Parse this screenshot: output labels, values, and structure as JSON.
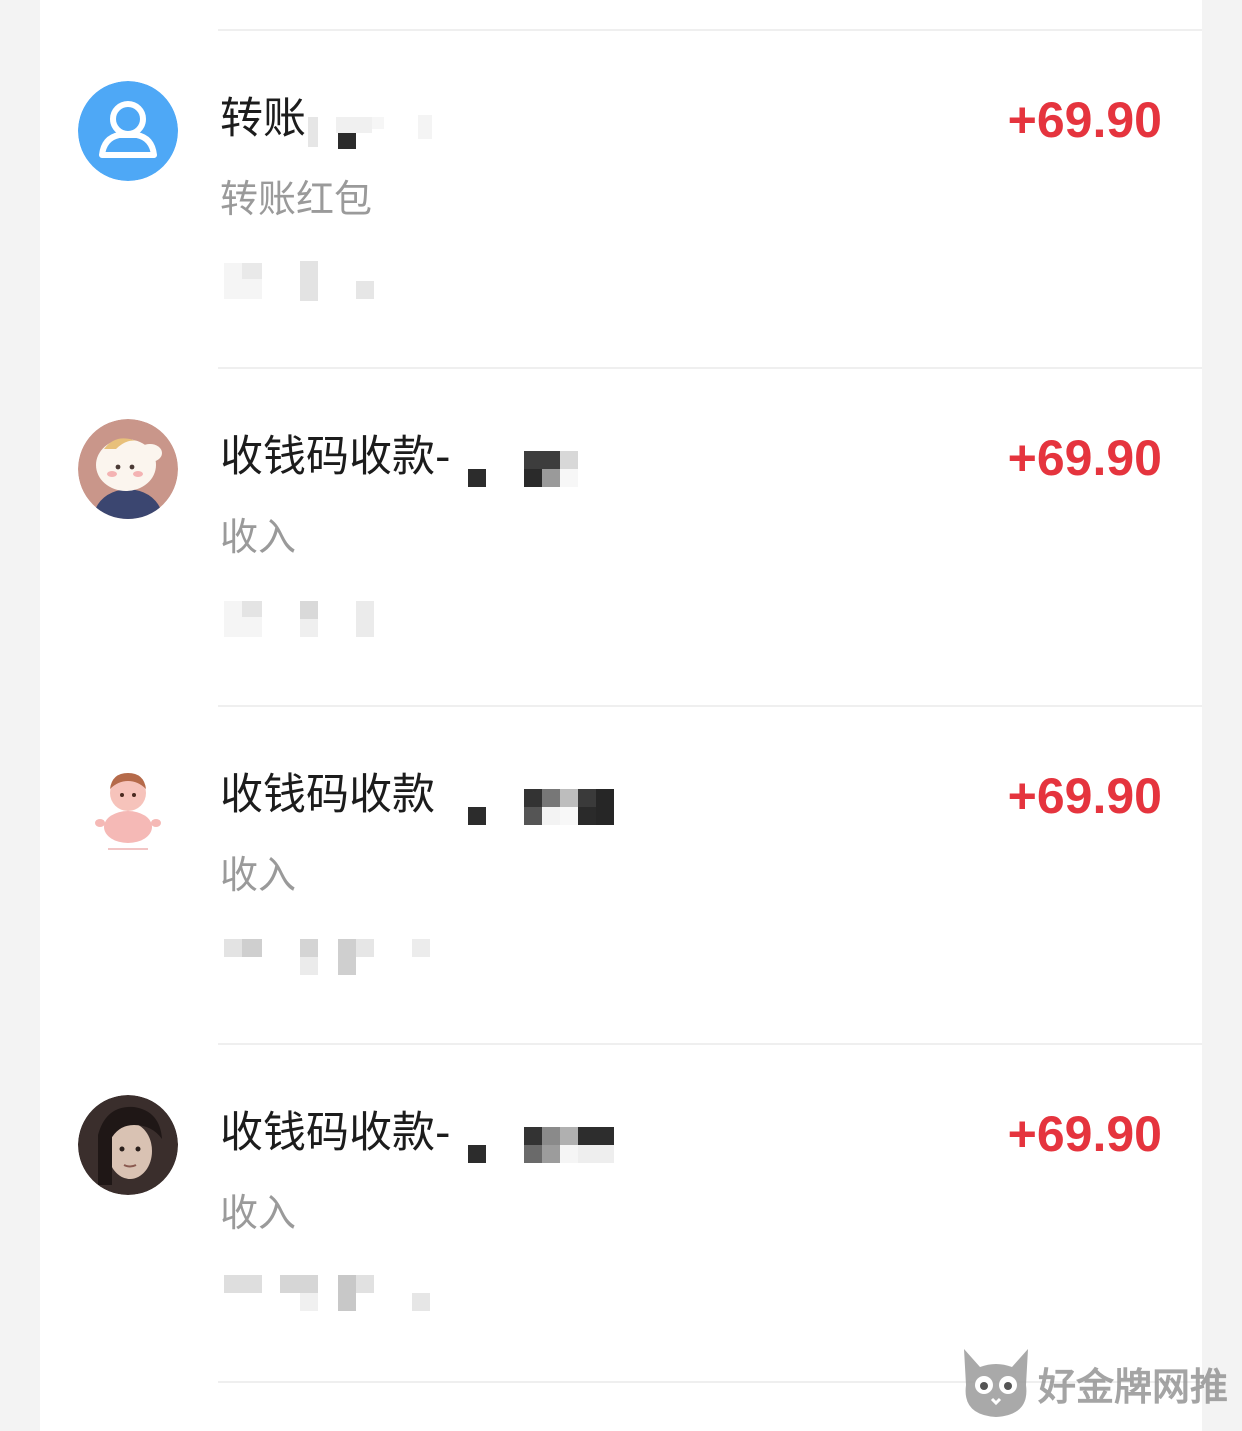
{
  "transactions": [
    {
      "avatar_icon": "default-user-avatar-icon",
      "title": "转账",
      "subtitle": "转账红包",
      "amount": "+69.90"
    },
    {
      "avatar_icon": "cartoon-sheep-avatar",
      "title": "收钱码收款-",
      "subtitle": "收入",
      "amount": "+69.90"
    },
    {
      "avatar_icon": "cartoon-pig-avatar",
      "title": "收钱码收款",
      "subtitle": "收入",
      "amount": "+69.90"
    },
    {
      "avatar_icon": "photo-portrait-avatar",
      "title": "收钱码收款-",
      "subtitle": "收入",
      "amount": "+69.90"
    }
  ],
  "colors": {
    "amount": "#e5343e",
    "default_avatar": "#4ea8f6",
    "subtitle": "#9a9a9a"
  },
  "watermark": {
    "text": "好金牌网推",
    "icon": "cat-face-icon"
  }
}
